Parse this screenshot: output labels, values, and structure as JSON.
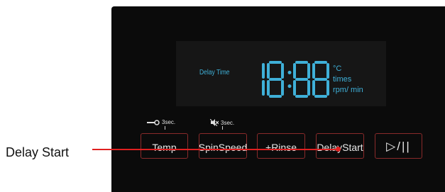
{
  "display": {
    "label": "Delay Time",
    "digits": "18:88",
    "units": [
      "°C",
      "times",
      "rpm/ min"
    ]
  },
  "hints": {
    "temp_hint": "3sec.",
    "spin_hint": "3sec."
  },
  "buttons": {
    "temp": "Temp",
    "spin_speed": "SpinSpeed",
    "rinse": "+Rinse",
    "delay_start": "DelayStart",
    "play_pause": "▷/||"
  },
  "callout": {
    "label": "Delay Start"
  },
  "colors": {
    "panel": "#0b0b0b",
    "display_accent": "#3fb0d8",
    "button_border": "#8a2a2a",
    "callout_line": "#e02020"
  },
  "icons": {
    "temp_hint_icon": "key-lock-icon",
    "spin_hint_icon": "mute-icon"
  }
}
